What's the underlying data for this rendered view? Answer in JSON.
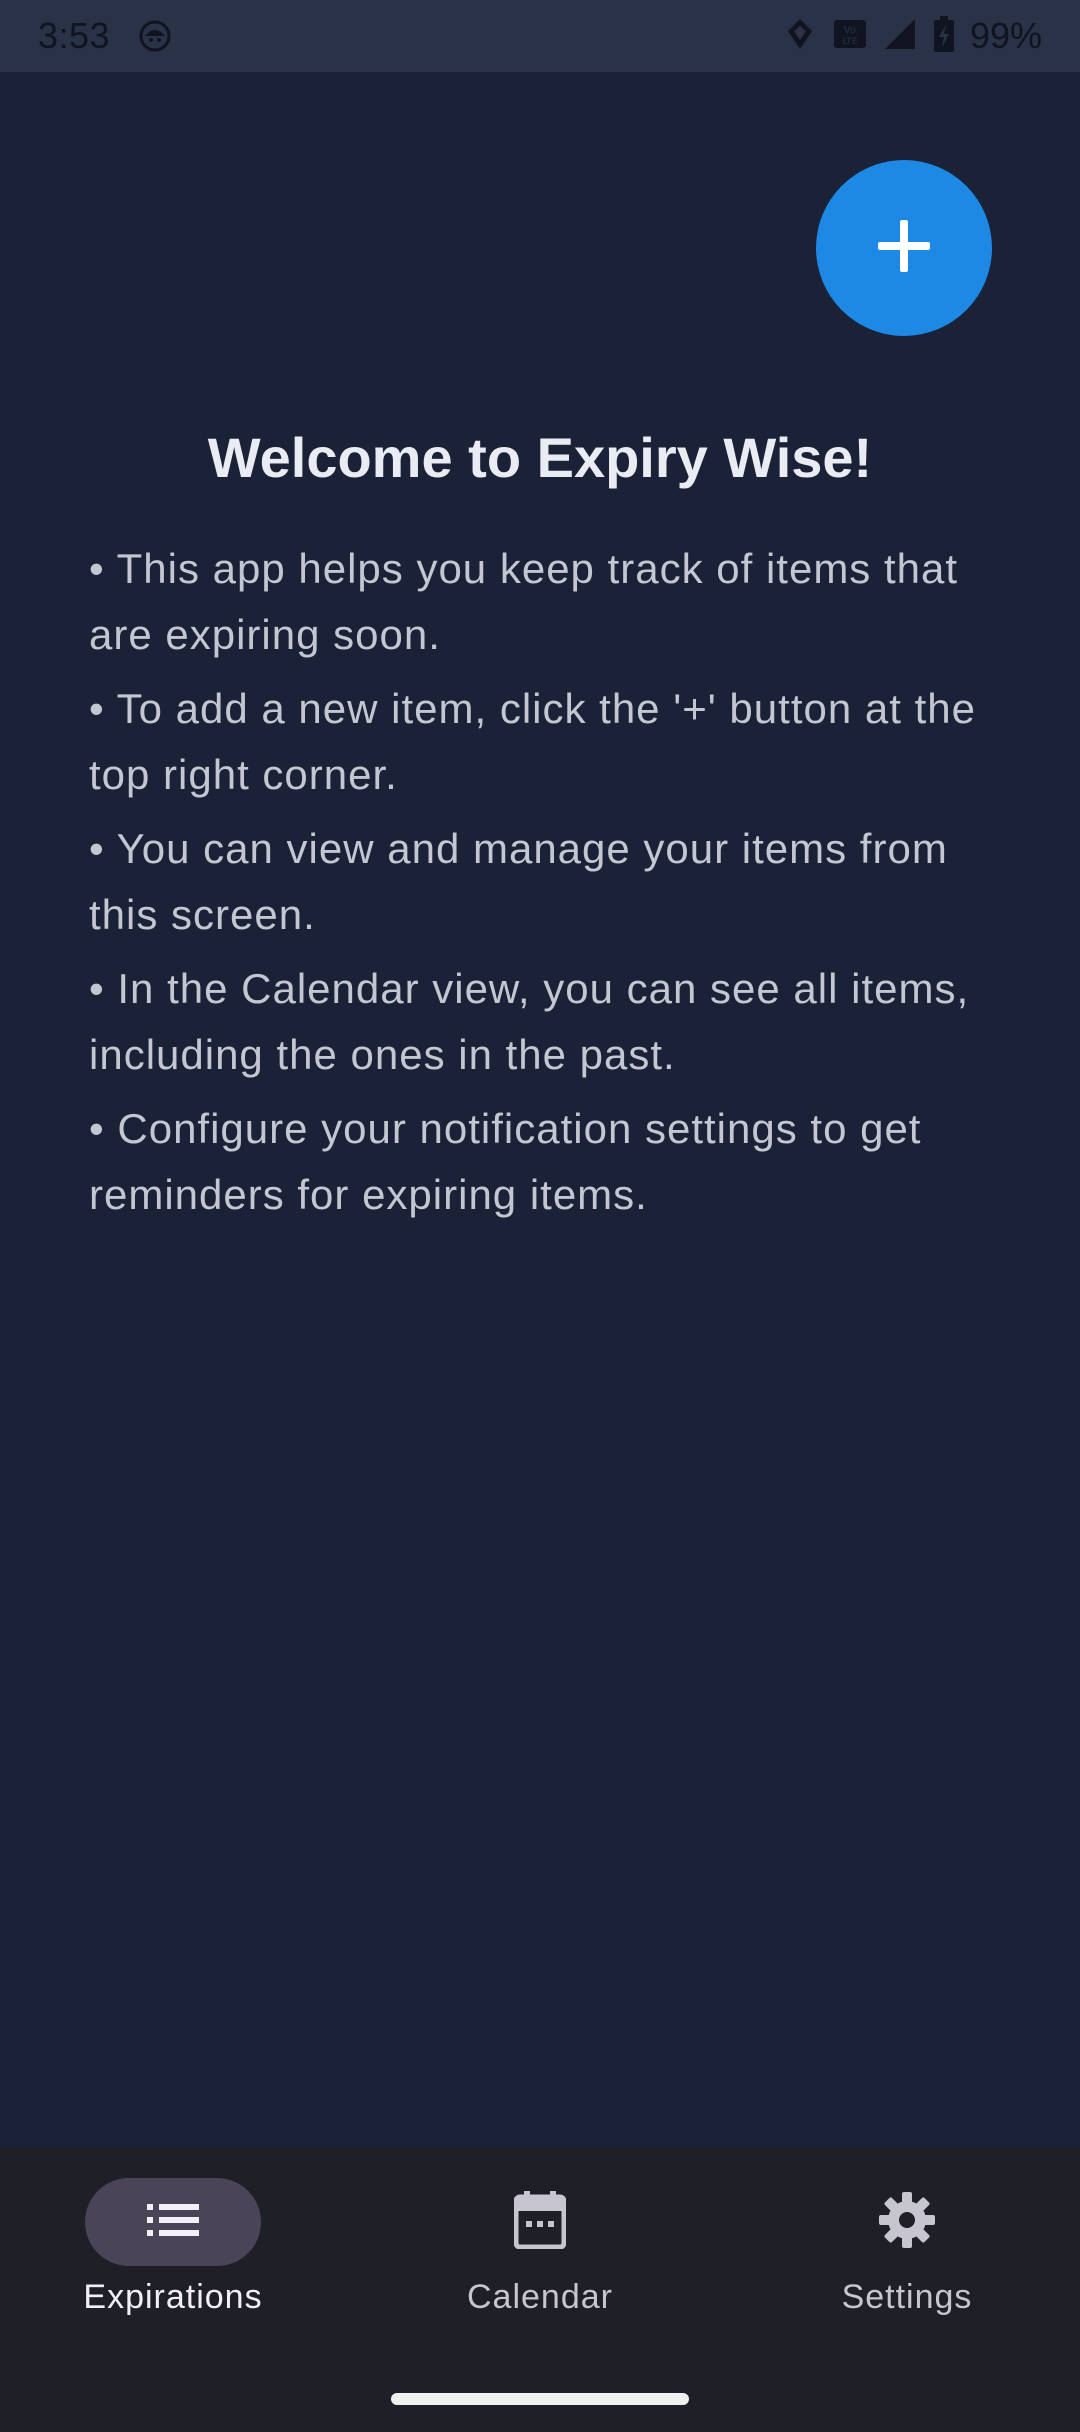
{
  "status_bar": {
    "time": "3:53",
    "battery_percent": "99%",
    "icons": [
      "android-head-icon",
      "data-saver-icon",
      "volte-icon",
      "signal-icon",
      "battery-charging-icon"
    ]
  },
  "fab": {
    "label": "+",
    "icon": "plus-icon",
    "color": "#1e88e5"
  },
  "welcome": {
    "title": "Welcome to Expiry Wise!",
    "tips": [
      "• This app helps you keep track of items that are expiring soon.",
      "• To add a new item, click the '+' button at the top right corner.",
      "• You can view and manage your items from this screen.",
      "• In the Calendar view, you can see all items, including the ones in the past.",
      "• Configure your notification settings to get reminders for expiring items."
    ]
  },
  "bottom_nav": {
    "items": [
      {
        "label": "Expirations",
        "icon": "list-icon",
        "active": true
      },
      {
        "label": "Calendar",
        "icon": "calendar-icon",
        "active": false
      },
      {
        "label": "Settings",
        "icon": "gear-icon",
        "active": false
      }
    ]
  },
  "colors": {
    "background": "#1b2136",
    "status_bar": "#2a3247",
    "nav_background": "#1f1f27",
    "nav_active_pill": "#4a4458",
    "accent": "#1e88e5"
  }
}
